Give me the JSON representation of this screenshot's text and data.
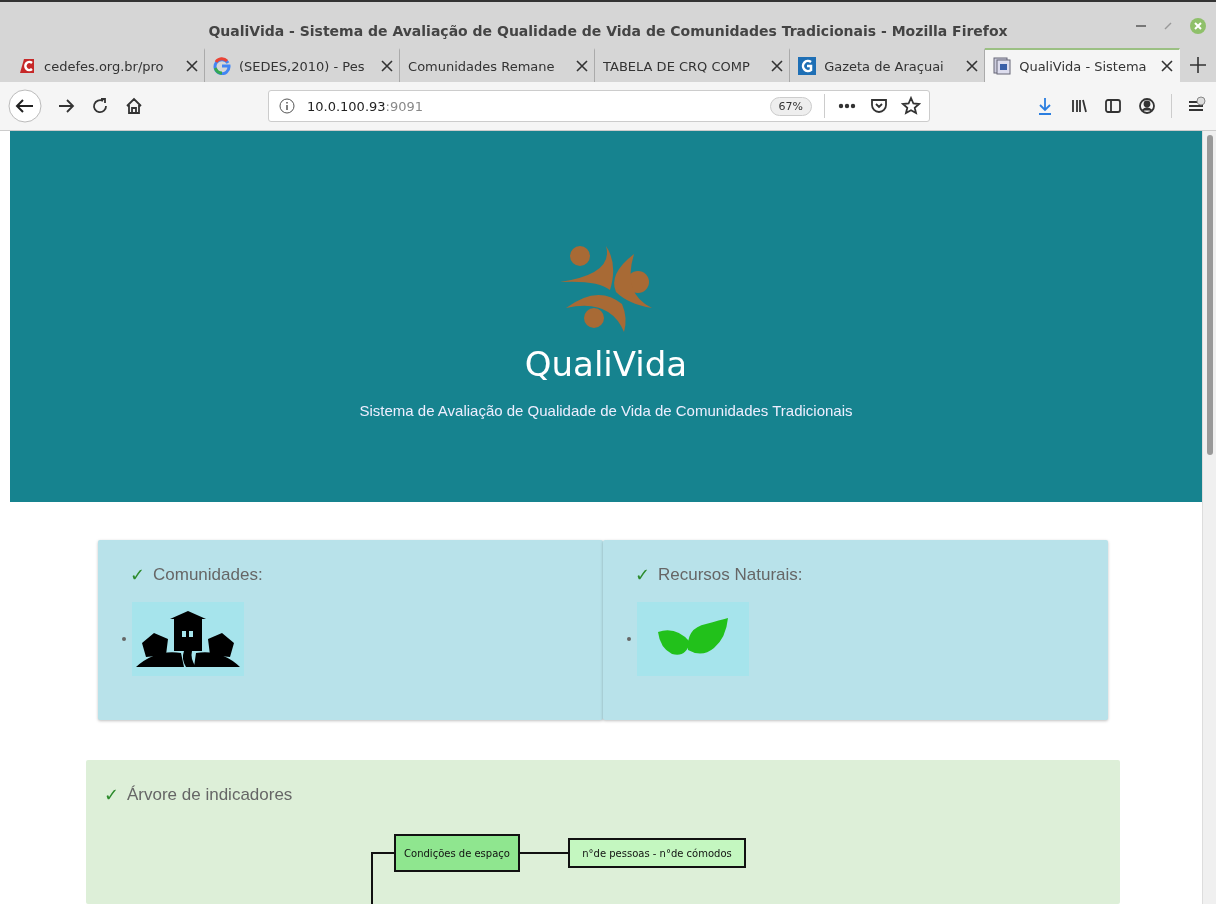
{
  "window": {
    "title": "QualiVida - Sistema de Avaliação de Qualidade de Vida de Comunidades Tradicionais - Mozilla Firefox"
  },
  "tabs": [
    {
      "label": "cedefes.org.br/pro",
      "kind": "red-square",
      "selected": false
    },
    {
      "label": "(SEDES,2010) - Pes",
      "kind": "ring",
      "selected": false
    },
    {
      "label": "Comunidades Remane",
      "kind": "none",
      "selected": false
    },
    {
      "label": "TABELA DE CRQ COMP",
      "kind": "none",
      "selected": false
    },
    {
      "label": "Gazeta de Araçuai",
      "kind": "blue-square",
      "selected": false
    },
    {
      "label": "QualiVida - Sistema",
      "kind": "page",
      "selected": true
    }
  ],
  "address": {
    "host": "10.0.100.93",
    "port": ":9091",
    "zoom": "67%"
  },
  "hero": {
    "title": "QualiVida",
    "subtitle": "Sistema de Avaliação de Qualidade de Vida de Comunidades Tradicionais"
  },
  "cards": [
    {
      "mark": "✓",
      "title": "Comunidades:",
      "kind": "houses"
    },
    {
      "mark": "✓",
      "title": "Recursos Naturais:",
      "kind": "leaves"
    }
  ],
  "tree": {
    "mark": "✓",
    "title": "Árvore de indicadores",
    "nodes": [
      {
        "label": "Condições de espaço",
        "children": [
          {
            "label": "n°de pessoas - n°de cómodos"
          }
        ]
      }
    ]
  }
}
